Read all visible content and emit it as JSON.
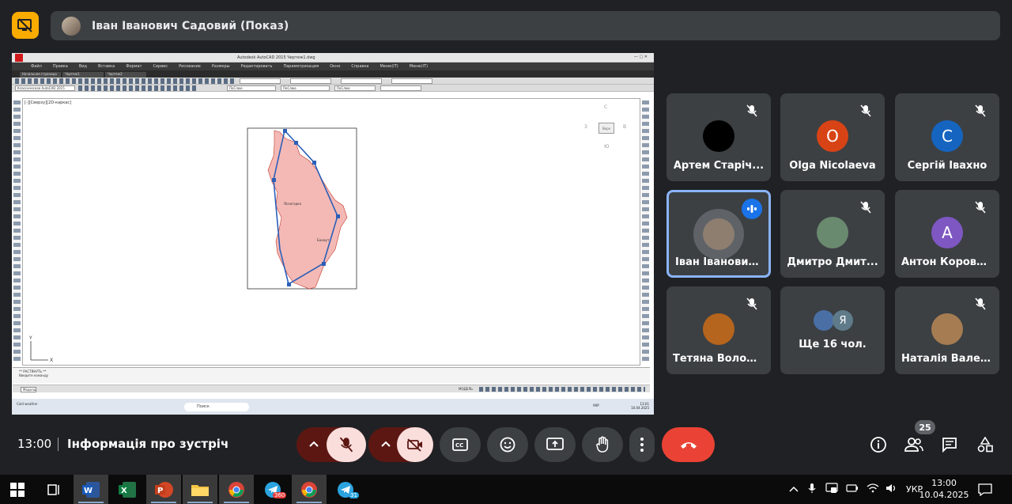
{
  "presenter": {
    "banner_name": "Іван Іванович Садовий (Показ)"
  },
  "autocad": {
    "title": "Autodesk AutoCAD 2015   Чертеж1.dwg",
    "menu": [
      "Файл",
      "Правка",
      "Вид",
      "Вставка",
      "Формат",
      "Сервис",
      "Рисование",
      "Размеры",
      "Редактировать",
      "Параметризация",
      "Окно",
      "Справка",
      "Меню(IT)",
      "Меню(IT)"
    ],
    "tabs": [
      "Начальная страница",
      "Чертеж1",
      "Чертеж2"
    ],
    "workspace": "Классическая AutoCAD 2015",
    "layer_field": "ПоСлою",
    "viewport_label": "[-][Сверху][2D-каркас]",
    "viewcube_label": "Верх",
    "cmd_line1": "** РАСТЯНУТЬ **",
    "cmd_line2": "Введите команду",
    "layout_tab": "Модель",
    "status_model": "МОДЕЛЬ",
    "win_search": "Поиск",
    "weather": "Cold weather",
    "win_lang": "УКР",
    "win_time": "13:01",
    "win_date": "10.04.2025",
    "map_labels": [
      "Ясногорка",
      "Бахмут"
    ]
  },
  "participants": [
    {
      "name": "Артем Старіч...",
      "initial": "",
      "avatar_color": "#000000",
      "speaking": false
    },
    {
      "name": "Olga Nicolaeva",
      "initial": "O",
      "avatar_color": "#d84315",
      "speaking": false
    },
    {
      "name": "Сергій Івахно",
      "initial": "С",
      "avatar_color": "#1565c0",
      "speaking": false
    },
    {
      "name": "Іван Іванович ...",
      "initial": "",
      "avatar_color": "#8d7e70",
      "speaking": true
    },
    {
      "name": "Дмитро Дмит...",
      "initial": "",
      "avatar_color": "#6a8a6f",
      "speaking": false
    },
    {
      "name": "Антон Коровч...",
      "initial": "А",
      "avatar_color": "#7e57c2",
      "speaking": false
    },
    {
      "name": "Тетяна Волод...",
      "initial": "",
      "avatar_color": "#b5651d",
      "speaking": false
    },
    {
      "name": "Ще 16 чол.",
      "initial": "Я",
      "avatar_color": "#5f7b8a",
      "speaking": false
    },
    {
      "name": "Наталія Вален...",
      "initial": "",
      "avatar_color": "#a67c52",
      "speaking": false
    }
  ],
  "meeting": {
    "time": "13:00",
    "title": "Інформація про зустріч",
    "participant_count": "25"
  },
  "taskbar": {
    "lang": "УКР",
    "time": "13:00",
    "date": "10.04.2025",
    "badge_360": "360",
    "badge_31": "31"
  },
  "colors": {
    "accent": "#8ab4f8",
    "end_call": "#ea4335",
    "present": "#f9ab00",
    "mute_bg": "#f9dedc"
  }
}
